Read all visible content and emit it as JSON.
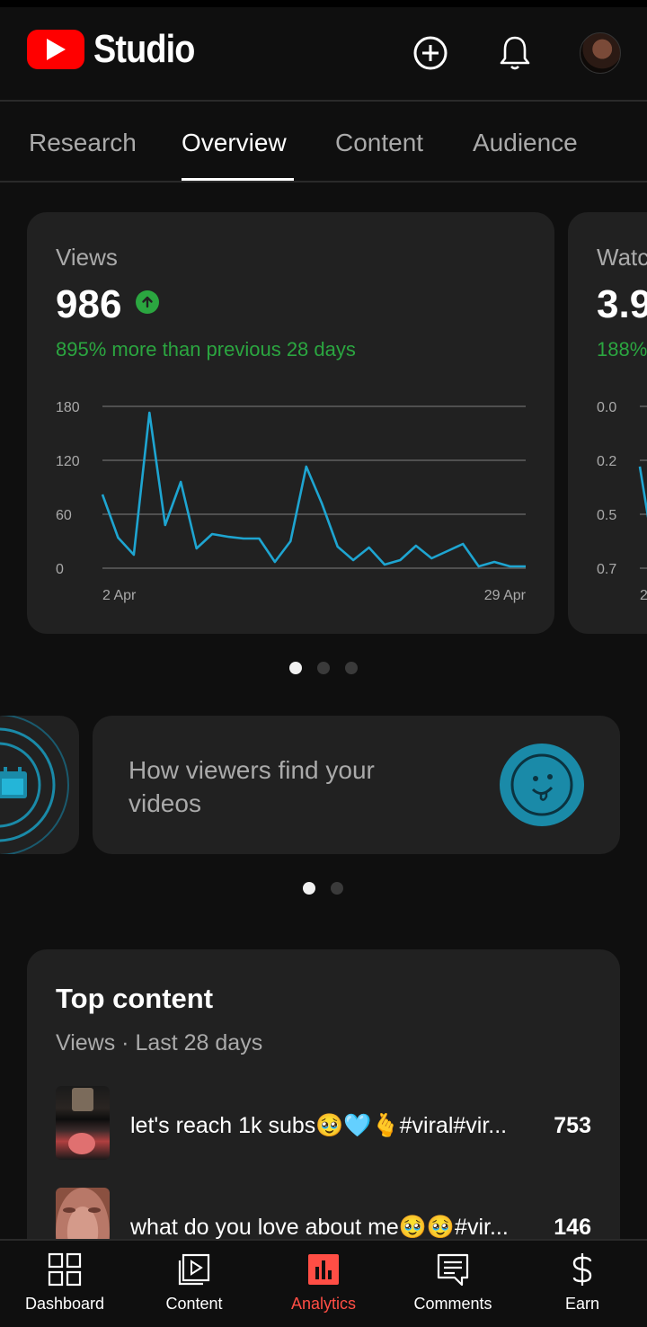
{
  "app": {
    "name": "Studio"
  },
  "header": {
    "create_icon": "create-plus-icon",
    "notifications_icon": "bell-icon",
    "account": "avatar"
  },
  "tabs": [
    {
      "label": "Research",
      "active": false
    },
    {
      "label": "Overview",
      "active": true
    },
    {
      "label": "Content",
      "active": false
    },
    {
      "label": "Audience",
      "active": false
    }
  ],
  "metric_cards": [
    {
      "label": "Views",
      "value": "986",
      "trend": "up",
      "delta_text": "895% more than previous 28 days"
    },
    {
      "label": "Watc",
      "value": "3.9",
      "delta_text": "188%"
    }
  ],
  "chart_data": [
    {
      "type": "line",
      "title": "Views",
      "x": [
        "2 Apr",
        "3 Apr",
        "4 Apr",
        "5 Apr",
        "6 Apr",
        "7 Apr",
        "8 Apr",
        "9 Apr",
        "10 Apr",
        "11 Apr",
        "12 Apr",
        "13 Apr",
        "14 Apr",
        "15 Apr",
        "16 Apr",
        "17 Apr",
        "18 Apr",
        "19 Apr",
        "20 Apr",
        "21 Apr",
        "22 Apr",
        "23 Apr",
        "24 Apr",
        "25 Apr",
        "26 Apr",
        "27 Apr",
        "28 Apr",
        "29 Apr"
      ],
      "xticks": [
        "2 Apr",
        "29 Apr"
      ],
      "series": [
        {
          "color": "#1ea5d1",
          "values": [
            82,
            34,
            15,
            173,
            48,
            96,
            22,
            38,
            35,
            33,
            33,
            7,
            30,
            113,
            72,
            24,
            9,
            23,
            4,
            9,
            25,
            11,
            19,
            27,
            2,
            7,
            2,
            2
          ]
        }
      ],
      "yticks": [
        0,
        60,
        120,
        180
      ],
      "ylim": [
        0,
        180
      ],
      "grid": true
    },
    {
      "type": "line",
      "title": "Watc",
      "yticks": [
        "0.0",
        "0.2",
        "0.5",
        "0.7"
      ],
      "xticks": [
        "2"
      ],
      "series": [
        {
          "color": "#1ea5d1",
          "values": [
            0.44,
            0.2
          ]
        }
      ],
      "ylim": [
        0,
        0.7
      ],
      "grid": true
    }
  ],
  "metric_pager": {
    "count": 3,
    "active": 0
  },
  "insights": {
    "left_icon": "calendar-icon",
    "title": "How viewers find your videos",
    "icon": "search-face-icon"
  },
  "insights_pager": {
    "count": 2,
    "active": 0
  },
  "top_content": {
    "title": "Top content",
    "subtitle": "Views · Last 28 days",
    "rows": [
      {
        "title": "let's reach 1k subs🥹🩵🫰#viral#vir...",
        "views": "753"
      },
      {
        "title": "what do you love about me🥹🥹#vir...",
        "views": "146"
      }
    ]
  },
  "bottom_nav": [
    {
      "label": "Dashboard",
      "icon": "dashboard-icon",
      "active": false
    },
    {
      "label": "Content",
      "icon": "content-play-icon",
      "active": false
    },
    {
      "label": "Analytics",
      "icon": "analytics-bar-icon",
      "active": true
    },
    {
      "label": "Comments",
      "icon": "comments-icon",
      "active": false
    },
    {
      "label": "Earn",
      "icon": "dollar-icon",
      "active": false
    }
  ],
  "colors": {
    "brand_red": "#ff0000",
    "accent_green": "#2ba640",
    "chart_line": "#1ea5d1",
    "active_nav": "#ff4e45",
    "card_bg": "#212121"
  }
}
